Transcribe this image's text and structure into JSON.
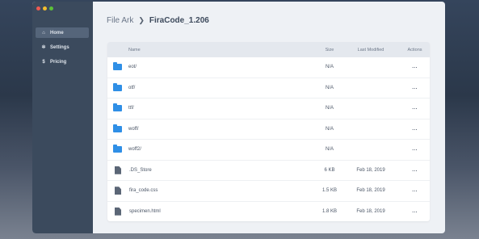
{
  "sidebar": {
    "items": [
      {
        "label": "Home",
        "icon": "home-icon",
        "active": true
      },
      {
        "label": "Settings",
        "icon": "gear-icon",
        "active": false
      },
      {
        "label": "Pricing",
        "icon": "pricing-icon",
        "active": false
      }
    ]
  },
  "breadcrumb": {
    "root": "File Ark",
    "current": "FiraCode_1.206"
  },
  "table": {
    "columns": {
      "name": "Name",
      "size": "Size",
      "modified": "Last Modified",
      "actions": "Actions"
    },
    "rows": [
      {
        "name": "eot/",
        "type": "folder",
        "size": "N/A",
        "modified": "",
        "actions": "..."
      },
      {
        "name": "otf/",
        "type": "folder",
        "size": "N/A",
        "modified": "",
        "actions": "..."
      },
      {
        "name": "ttf/",
        "type": "folder",
        "size": "N/A",
        "modified": "",
        "actions": "..."
      },
      {
        "name": "woff/",
        "type": "folder",
        "size": "N/A",
        "modified": "",
        "actions": "..."
      },
      {
        "name": "woff2/",
        "type": "folder",
        "size": "N/A",
        "modified": "",
        "actions": "..."
      },
      {
        "name": ".DS_Store",
        "type": "file",
        "size": "6 KB",
        "modified": "Feb 18, 2019",
        "actions": "..."
      },
      {
        "name": "fira_code.css",
        "type": "file",
        "size": "1.5 KB",
        "modified": "Feb 18, 2019",
        "actions": "..."
      },
      {
        "name": "specimen.html",
        "type": "file",
        "size": "1.8 KB",
        "modified": "Feb 18, 2019",
        "actions": "..."
      }
    ]
  },
  "colors": {
    "folder": "#2f8fe6",
    "sidebar": "#3b4a5d",
    "active": "#55657a"
  }
}
